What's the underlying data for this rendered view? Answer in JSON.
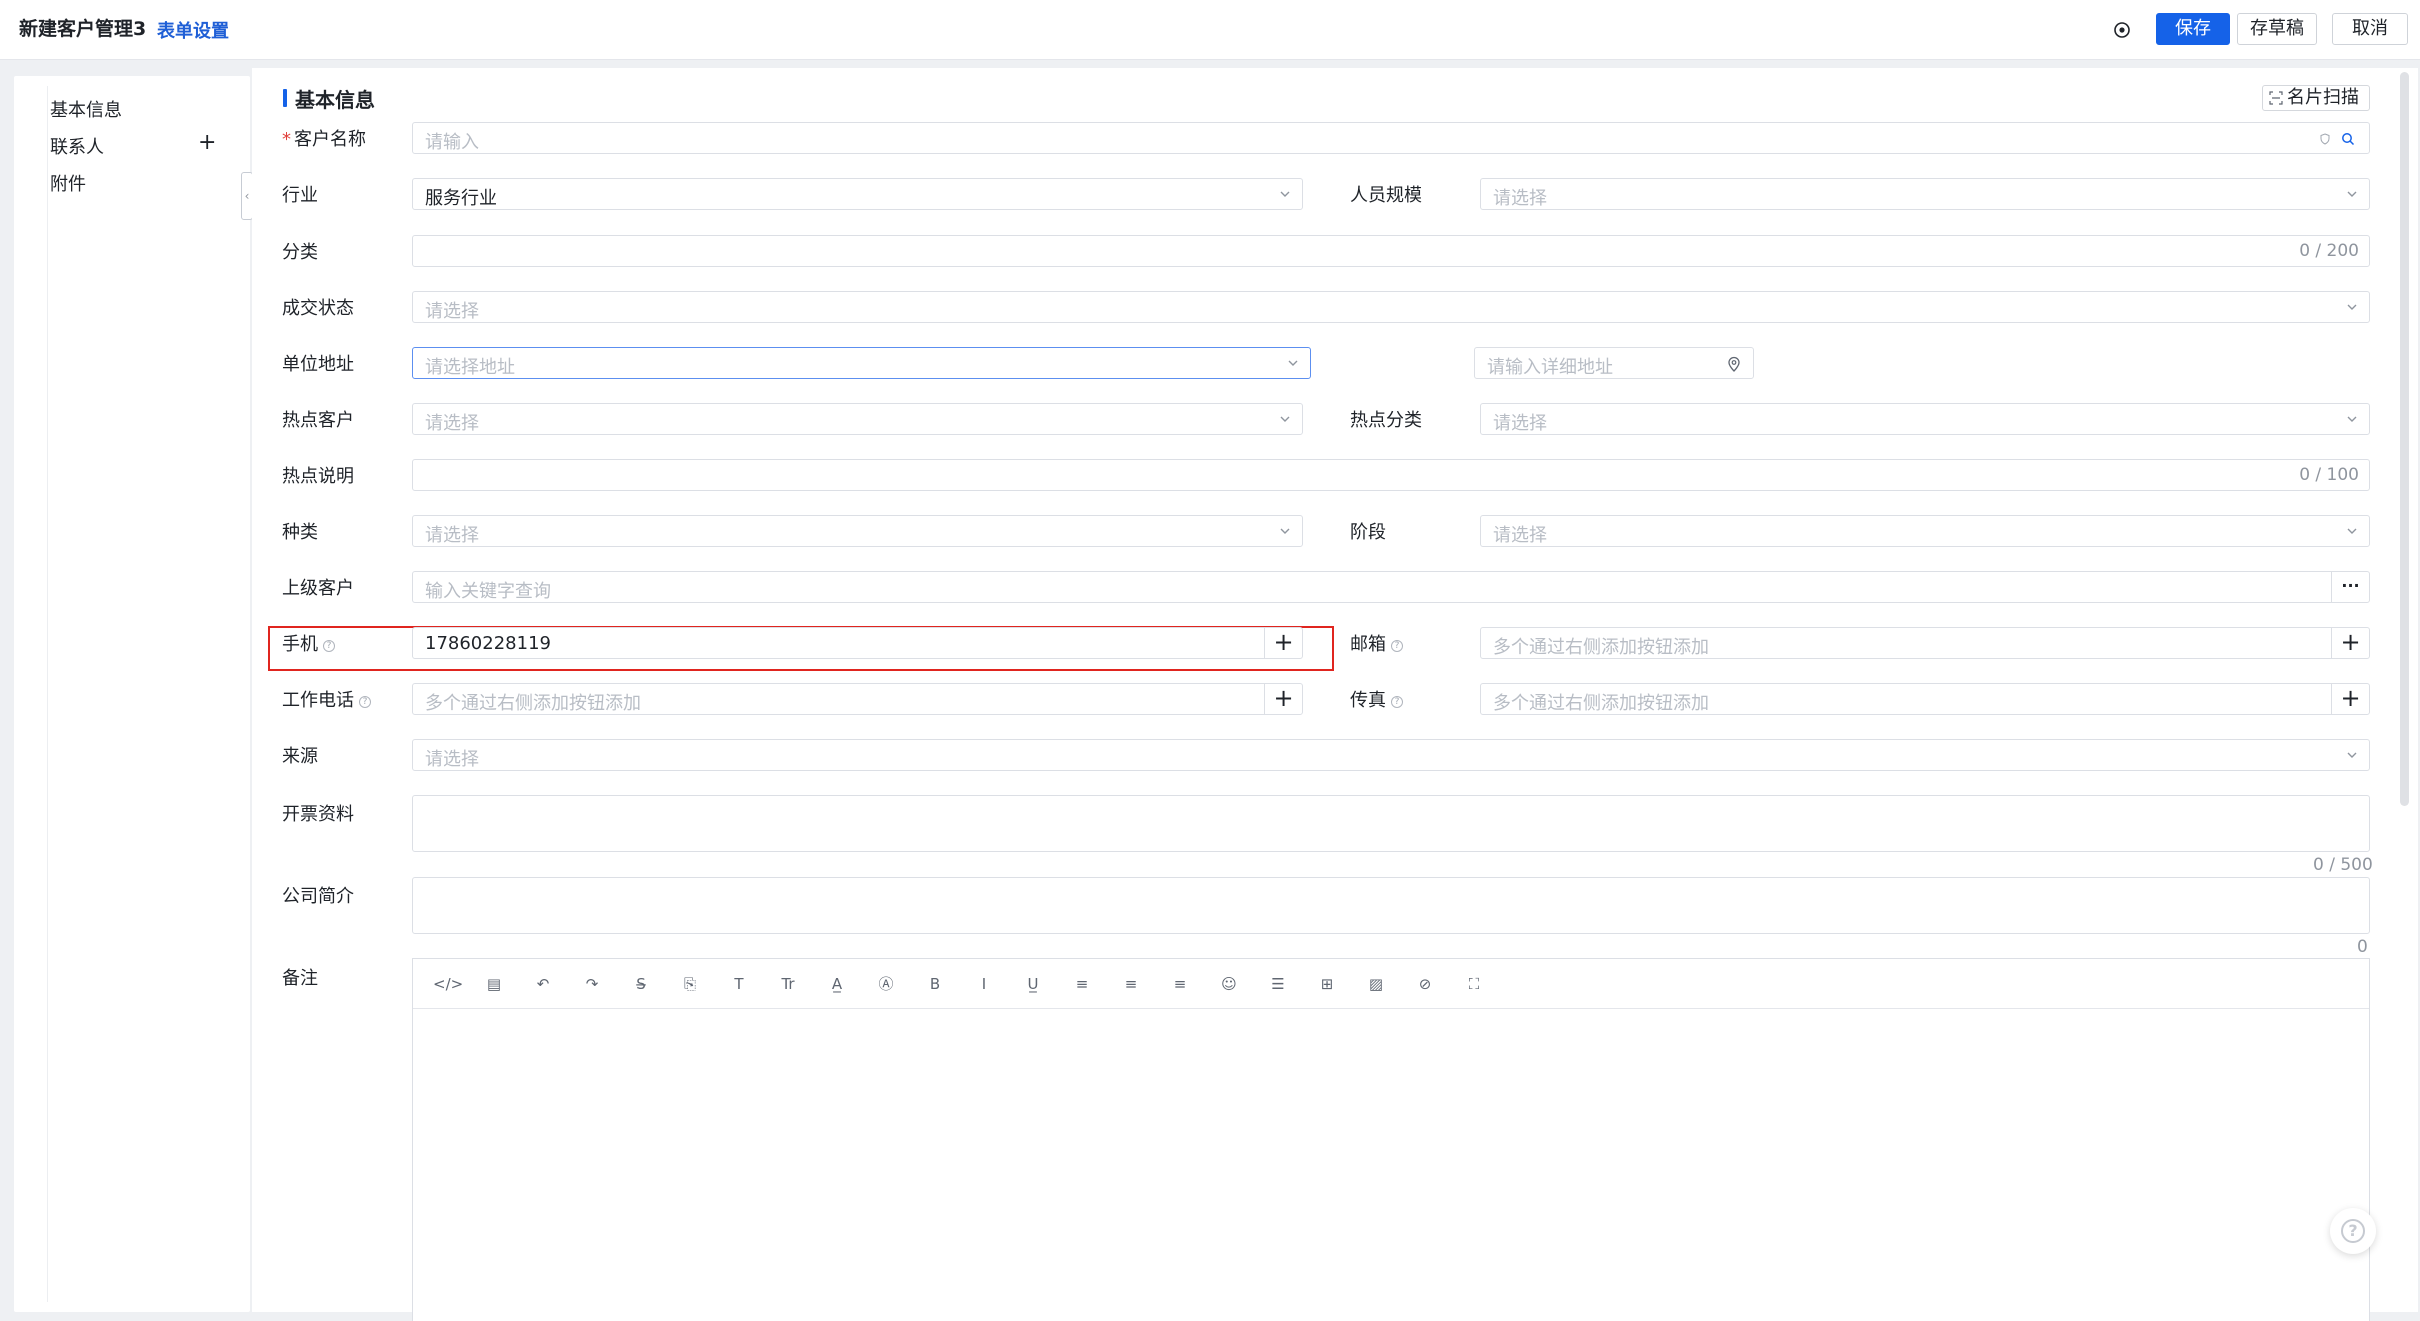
{
  "header": {
    "title": "新建客户管理3",
    "form_settings": "表单设置",
    "save": "保存",
    "draft": "存草稿",
    "cancel": "取消",
    "settings_icon": "gear-icon"
  },
  "sidebar": {
    "items": [
      {
        "label": "基本信息"
      },
      {
        "label": "联系人",
        "action": "+"
      },
      {
        "label": "附件"
      }
    ],
    "collapse_glyph": "‹"
  },
  "section": {
    "title": "基本信息",
    "scan_button": "名片扫描"
  },
  "form": {
    "customer_name": {
      "label": "客户名称",
      "required": "*",
      "placeholder": "请输入"
    },
    "industry": {
      "label": "行业",
      "value": "服务行业"
    },
    "staff_size": {
      "label": "人员规模",
      "placeholder": "请选择"
    },
    "category": {
      "label": "分类",
      "count": "0 / 200"
    },
    "deal_status": {
      "label": "成交状态",
      "placeholder": "请选择"
    },
    "address": {
      "label": "单位地址",
      "placeholder": "请选择地址",
      "detail_placeholder": "请输入详细地址"
    },
    "hot_customer": {
      "label": "热点客户",
      "placeholder": "请选择"
    },
    "hot_category": {
      "label": "热点分类",
      "placeholder": "请选择"
    },
    "hot_note": {
      "label": "热点说明",
      "count": "0 / 100"
    },
    "kind": {
      "label": "种类",
      "placeholder": "请选择"
    },
    "stage": {
      "label": "阶段",
      "placeholder": "请选择"
    },
    "parent_customer": {
      "label": "上级客户",
      "placeholder": "输入关键字查询",
      "more": "···"
    },
    "mobile": {
      "label": "手机",
      "value": "17860228119",
      "add": "+"
    },
    "email": {
      "label": "邮箱",
      "placeholder": "多个通过右侧添加按钮添加",
      "add": "+"
    },
    "work_phone": {
      "label": "工作电话",
      "placeholder": "多个通过右侧添加按钮添加",
      "add": "+"
    },
    "fax": {
      "label": "传真",
      "placeholder": "多个通过右侧添加按钮添加",
      "add": "+"
    },
    "source": {
      "label": "来源",
      "placeholder": "请选择"
    },
    "invoice_info": {
      "label": "开票资料",
      "count": "0 / 500"
    },
    "company_intro": {
      "label": "公司简介",
      "count": "0"
    },
    "remarks": {
      "label": "备注"
    }
  },
  "editor_toolbar": [
    {
      "name": "code-view-icon",
      "glyph": "</>"
    },
    {
      "name": "template-icon",
      "glyph": "▤"
    },
    {
      "name": "undo-icon",
      "glyph": "↶"
    },
    {
      "name": "redo-icon",
      "glyph": "↷"
    },
    {
      "name": "strikethrough-icon",
      "glyph": "S̶"
    },
    {
      "name": "clear-format-icon",
      "glyph": "⎘"
    },
    {
      "name": "font-size-icon",
      "glyph": "T"
    },
    {
      "name": "text-style-icon",
      "glyph": "Tr"
    },
    {
      "name": "font-color-icon",
      "glyph": "A̲"
    },
    {
      "name": "background-color-icon",
      "glyph": "Ⓐ"
    },
    {
      "name": "bold-icon",
      "glyph": "B"
    },
    {
      "name": "italic-icon",
      "glyph": "I"
    },
    {
      "name": "underline-icon",
      "glyph": "U̲"
    },
    {
      "name": "align-left-icon",
      "glyph": "≡"
    },
    {
      "name": "align-center-icon",
      "glyph": "≡"
    },
    {
      "name": "align-right-icon",
      "glyph": "≡"
    },
    {
      "name": "emoji-icon",
      "glyph": "☺"
    },
    {
      "name": "horizontal-rule-icon",
      "glyph": "☰"
    },
    {
      "name": "table-icon",
      "glyph": "⊞"
    },
    {
      "name": "image-icon",
      "glyph": "▨"
    },
    {
      "name": "attachment-icon",
      "glyph": "⊘"
    },
    {
      "name": "fullscreen-icon",
      "glyph": "⛶"
    }
  ],
  "help_float": "?",
  "colors": {
    "primary": "#1562e8",
    "highlight": "#e0251f",
    "required": "#e0403b"
  }
}
